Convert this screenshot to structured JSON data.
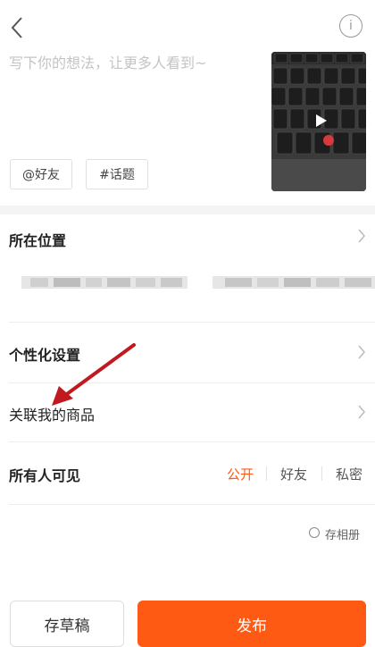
{
  "post": {
    "placeholder": "写下你的想法，让更多人看到~",
    "mention_button": "@好友",
    "topic_button": "#话题"
  },
  "settings": {
    "location_label": "所在位置",
    "personalize_label": "个性化设置",
    "link_products_label": "关联我的商品",
    "visibility_label": "所有人可见",
    "visibility_options": [
      "公开",
      "好友",
      "私密"
    ],
    "selected_visibility": "公开"
  },
  "footer": {
    "save_album_label": "存相册",
    "draft_button": "存草稿",
    "publish_button": "发布"
  },
  "colors": {
    "accent": "#ff5a14",
    "annotation_arrow": "#c0191f"
  },
  "icons": {
    "back": "chevron-left-icon",
    "info": "info-icon",
    "row_chevron": "chevron-right-icon",
    "play": "play-icon"
  }
}
